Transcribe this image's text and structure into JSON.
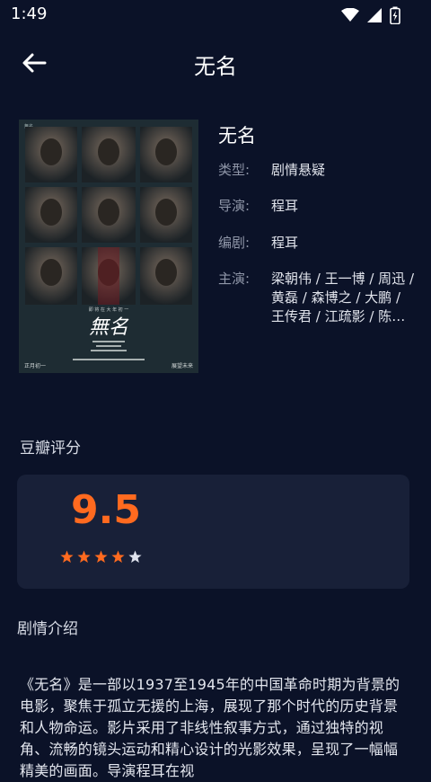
{
  "status": {
    "time": "1:49"
  },
  "header": {
    "title": "无名"
  },
  "movie": {
    "title": "无名",
    "genre_label": "类型:",
    "genre": "剧情悬疑",
    "director_label": "导演:",
    "director": "程耳",
    "writer_label": "编剧:",
    "writer": "程耳",
    "cast_label": "主演:",
    "cast": "梁朝伟 / 王一博 / 周迅 / 黄磊 / 森博之 / 大鹏 / 王传君 / 江疏影 / 陈永胜",
    "poster": {
      "title_text": "無名",
      "tagline": "即 将 在 大 年 初 一",
      "date_left": "正月初一",
      "date_right": "展望未来"
    }
  },
  "rating": {
    "section_title": "豆瓣评分",
    "score": "9.5",
    "stars": 4.5,
    "star_color": "#ff6a1f",
    "empty_star_color": "#dfe3ee"
  },
  "synopsis": {
    "section_title": "剧情介绍",
    "text": "《无名》是一部以1937至1945年的中国革命时期为背景的电影，聚焦于孤立无援的上海，展现了那个时代的历史背景和人物命运。影片采用了非线性叙事方式，通过独特的视角、流畅的镜头运动和精心设计的光影效果，呈现了一幅幅精美的画面。导演程耳在视"
  },
  "colors": {
    "background": "#0b1228",
    "card": "#182038",
    "accent": "#ff6a1f"
  }
}
